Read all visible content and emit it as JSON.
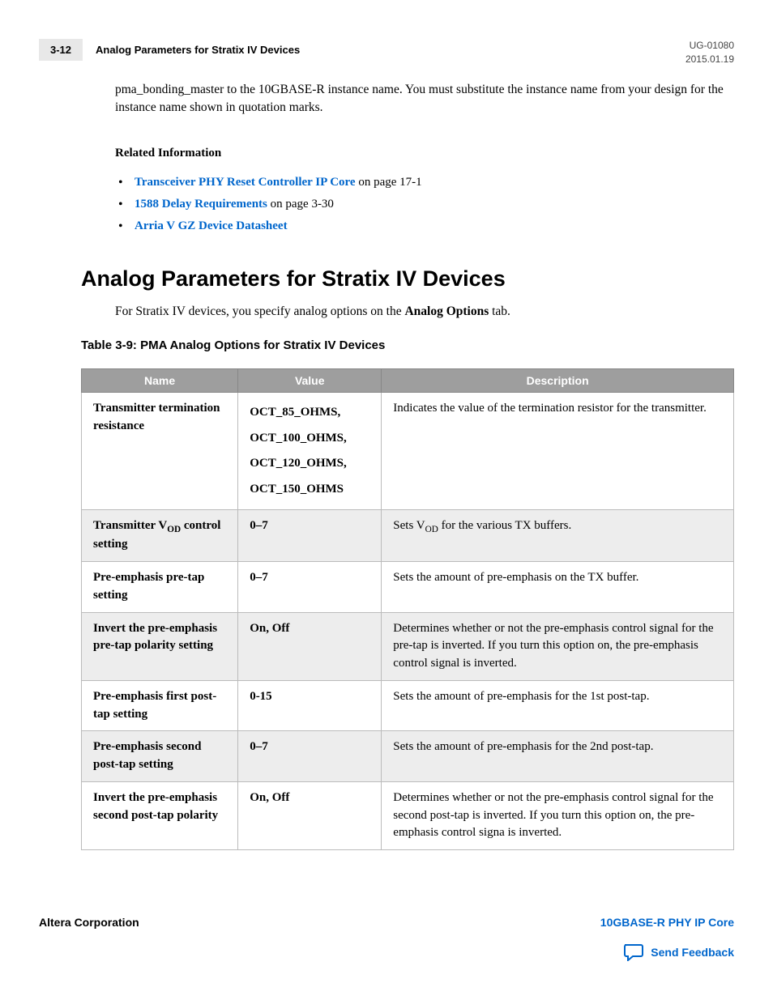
{
  "header": {
    "page_num": "3-12",
    "title": "Analog Parameters for Stratix IV Devices",
    "doc_id": "UG-01080",
    "date": "2015.01.19"
  },
  "top_paragraph": "pma_bonding_master to the 10GBASE-R instance name. You must substitute the instance name from your design for the instance name shown in quotation marks.",
  "related": {
    "heading": "Related Information",
    "items": [
      {
        "link": "Transceiver PHY Reset Controller IP Core",
        "suffix": " on page 17-1"
      },
      {
        "link": "1588 Delay Requirements",
        "suffix": " on page 3-30"
      },
      {
        "link": "Arria V GZ Device Datasheet",
        "suffix": ""
      }
    ]
  },
  "section": {
    "heading": "Analog Parameters for Stratix IV Devices",
    "intro_pre": "For Stratix IV devices, you specify analog options on the ",
    "intro_bold": "Analog Options",
    "intro_post": " tab."
  },
  "table": {
    "caption": "Table 3-9: PMA Analog Options for Stratix IV Devices",
    "headers": {
      "name": "Name",
      "value": "Value",
      "desc": "Description"
    },
    "rows": [
      {
        "name": "Transmitter termination resistance",
        "value_lines": [
          "OCT_85_OHMS,",
          "OCT_100_OHMS,",
          "OCT_120_OHMS,",
          "OCT_150_OHMS"
        ],
        "desc": "Indicates the value of the termination resistor for the transmitter."
      },
      {
        "name_html": "Transmitter V<sub>OD</sub> control setting",
        "value": "0–7",
        "desc_html": "Sets V<sub>OD</sub> for the various TX buffers."
      },
      {
        "name": "Pre-emphasis pre-tap setting",
        "value": "0–7",
        "desc": "Sets the amount of pre-emphasis on the TX buffer."
      },
      {
        "name": "Invert the pre-emphasis pre-tap polarity setting",
        "value": "On, Off",
        "desc": "Determines whether or not the pre-emphasis control signal for the pre-tap is inverted. If you turn this option on, the pre-emphasis control signal is inverted."
      },
      {
        "name": "Pre-emphasis first post-tap setting",
        "value": "0-15",
        "desc": "Sets the amount of pre-emphasis for the 1st post-tap."
      },
      {
        "name": "Pre-emphasis second post-tap setting",
        "value": "0–7",
        "desc": "Sets the amount of pre-emphasis for the 2nd post-tap."
      },
      {
        "name": "Invert the pre-emphasis second post-tap polarity",
        "value": "On, Off",
        "desc": "Determines whether or not the pre-emphasis control signal for the second post-tap is inverted. If you turn this option on, the pre-emphasis control signa is inverted."
      }
    ]
  },
  "footer": {
    "left": "Altera Corporation",
    "right": "10GBASE-R PHY IP Core",
    "feedback": "Send Feedback"
  }
}
